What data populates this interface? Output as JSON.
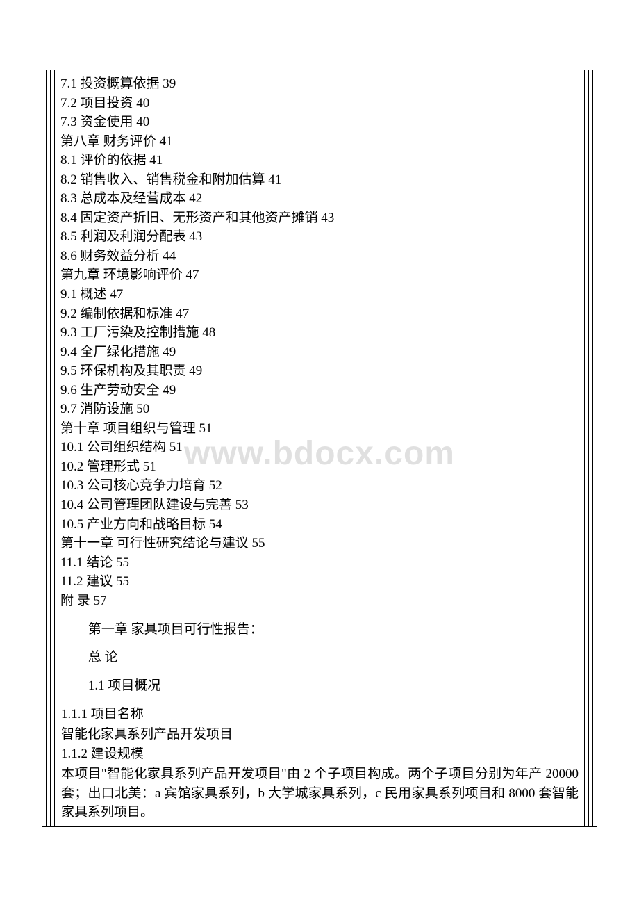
{
  "watermark": "www.bdocx.com",
  "toc": {
    "l7_1": "7.1 投资概算依据 39",
    "l7_2": "7.2 项目投资 40",
    "l7_3": "7.3 资金使用 40",
    "ch8": "第八章 财务评价 41",
    "l8_1": "8.1 评价的依据 41",
    "l8_2": "8.2 销售收入、销售税金和附加估算 41",
    "l8_3": "8.3 总成本及经营成本 42",
    "l8_4": "8.4 固定资产折旧、无形资产和其他资产摊销 43",
    "l8_5": "8.5 利润及利润分配表 43",
    "l8_6": "8.6 财务效益分析 44",
    "ch9": "第九章 环境影响评价 47",
    "l9_1": "9.1 概述 47",
    "l9_2": "9.2 编制依据和标准 47",
    "l9_3": "9.3 工厂污染及控制措施 48",
    "l9_4": "9.4 全厂绿化措施 49",
    "l9_5": "9.5 环保机构及其职责 49",
    "l9_6": "9.6 生产劳动安全 49",
    "l9_7": "9.7 消防设施 50",
    "ch10": "第十章 项目组织与管理 51",
    "l10_1": "10.1 公司组织结构 51",
    "l10_2": "10.2 管理形式 51",
    "l10_3": "10.3 公司核心竞争力培育 52",
    "l10_4": "10.4 公司管理团队建设与完善 53",
    "l10_5": "10.5 产业方向和战略目标 54",
    "ch11": "第十一章 可行性研究结论与建议 55",
    "l11_1": "11.1 结论 55",
    "l11_2": "11.2 建议 55",
    "appendix": "附  录 57"
  },
  "body": {
    "h1": "第一章 家具项目可行性报告：",
    "h2": "总 论",
    "h3": "1.1 项目概况",
    "s1_1_1": "1.1.1 项目名称",
    "s1_1_1_text": " 智能化家具系列产品开发项目",
    "s1_1_2": "1.1.2 建设规模",
    "s1_1_2_text": " 本项目\"智能化家具系列产品开发项目\"由 2 个子项目构成。两个子项目分别为年产 20000 套；出口北美：a 宾馆家具系列，b 大学城家具系列，c 民用家具系列项目和 8000 套智能家具系列项目。"
  }
}
